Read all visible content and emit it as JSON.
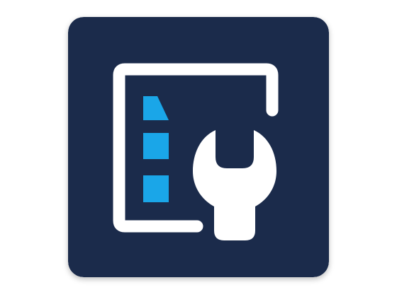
{
  "app_icon": {
    "name": "tools-maintenance-app-icon",
    "background_color": "#1b2b4b",
    "frame_color": "#ffffff",
    "wrench_color": "#ffffff",
    "document_bar_color": "#1aa6e8",
    "icons": [
      "document-frame-icon",
      "wrench-icon",
      "document-bars-icon"
    ]
  }
}
